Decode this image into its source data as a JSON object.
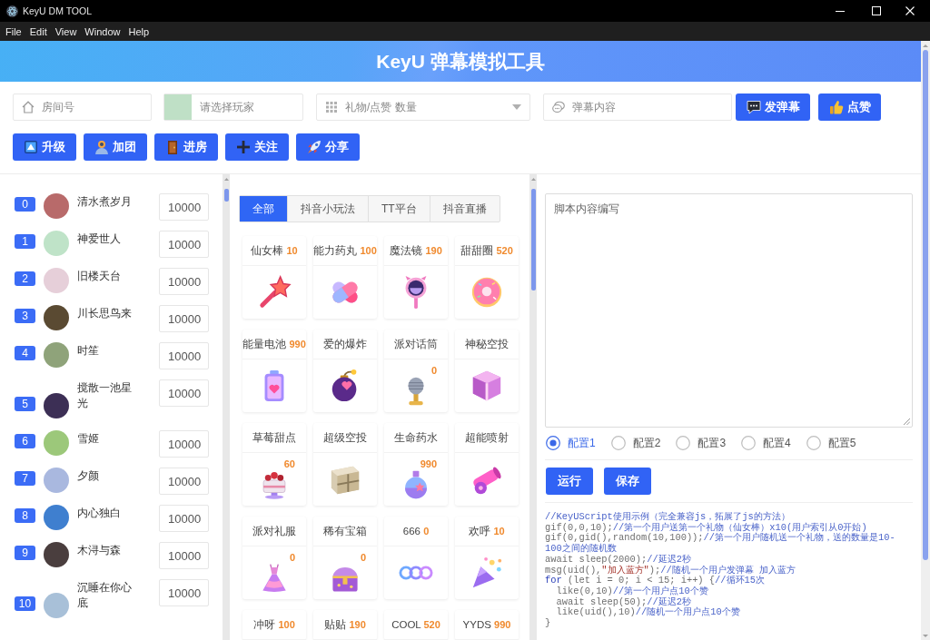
{
  "window": {
    "title": "KeyU DM TOOL"
  },
  "menu": [
    "File",
    "Edit",
    "View",
    "Window",
    "Help"
  ],
  "header": {
    "title": "KeyU 弹幕模拟工具"
  },
  "toolbar": {
    "room_field": {
      "placeholder": "房间号"
    },
    "player_select": {
      "placeholder": "请选择玩家"
    },
    "count_select": {
      "placeholder": "礼物/点赞 数量"
    },
    "danmaku_field": {
      "placeholder": "弹幕内容"
    },
    "buttons": [
      "发弹幕",
      "点赞"
    ],
    "actions": [
      "升级",
      "加团",
      "进房",
      "关注",
      "分享"
    ]
  },
  "players": [
    {
      "index": "0",
      "name": "清水煮岁月",
      "amount": "10000"
    },
    {
      "index": "1",
      "name": "神爱世人",
      "amount": "10000"
    },
    {
      "index": "2",
      "name": "旧楼天台",
      "amount": "10000"
    },
    {
      "index": "3",
      "name": "川长思鸟来",
      "amount": "10000"
    },
    {
      "index": "4",
      "name": "时笙",
      "amount": "10000"
    },
    {
      "index": "5",
      "name": "搅散一池星光",
      "amount": "10000"
    },
    {
      "index": "6",
      "name": "雪姬",
      "amount": "10000"
    },
    {
      "index": "7",
      "name": "夕颜",
      "amount": "10000"
    },
    {
      "index": "8",
      "name": "内心独白",
      "amount": "10000"
    },
    {
      "index": "9",
      "name": "木浔与森",
      "amount": "10000"
    },
    {
      "index": "10",
      "name": "沉睡在你心底",
      "amount": "10000"
    }
  ],
  "gift_tabs": [
    {
      "label": "全部",
      "selected": true
    },
    {
      "label": "抖音小玩法",
      "selected": false
    },
    {
      "label": "TT平台",
      "selected": false
    },
    {
      "label": "抖音直播",
      "selected": false
    }
  ],
  "gifts": [
    {
      "name": "仙女棒",
      "price": "10"
    },
    {
      "name": "能力药丸",
      "price": "100"
    },
    {
      "name": "魔法镜",
      "price": "190"
    },
    {
      "name": "甜甜圈",
      "price": "520"
    },
    {
      "name": "能量电池",
      "price": "990"
    },
    {
      "name": "爱的爆炸"
    },
    {
      "name": "派对话筒",
      "price_fragment": "0"
    },
    {
      "name": "神秘空投"
    },
    {
      "name": "草莓甜点",
      "price_fragment": "60"
    },
    {
      "name": "超级空投"
    },
    {
      "name": "生命药水",
      "price_fragment": "990"
    },
    {
      "name": "超能喷射"
    },
    {
      "name": "派对礼服",
      "price_fragment": "0"
    },
    {
      "name": "稀有宝箱",
      "price_fragment": "0"
    },
    {
      "name": "666",
      "price": "0"
    },
    {
      "name": "欢呼",
      "price": "10"
    },
    {
      "name": "冲呀",
      "price": "100"
    },
    {
      "name": "贴贴",
      "price": "190"
    },
    {
      "name": "COOL",
      "price": "520"
    },
    {
      "name": "YYDS",
      "price": "990"
    }
  ],
  "script": {
    "placeholder": "脚本内容编写",
    "configs": [
      {
        "label": "配置1",
        "selected": true
      },
      {
        "label": "配置2",
        "selected": false
      },
      {
        "label": "配置3",
        "selected": false
      },
      {
        "label": "配置4",
        "selected": false
      },
      {
        "label": "配置5",
        "selected": false
      }
    ],
    "buttons": [
      "运行",
      "保存"
    ],
    "code": [
      {
        "parts": [
          {
            "kind": "comment",
            "text": "//KeyUScript使用示例（完全兼容js，拓展了js的方法）"
          }
        ]
      },
      {
        "parts": [
          {
            "kind": "code",
            "text": "gif(0,0,10);"
          },
          {
            "kind": "comment",
            "text": "//第一个用户送第一个礼物（仙女棒）x10(用户索引从0开始)"
          }
        ]
      },
      {
        "parts": [
          {
            "kind": "code",
            "text": "gif(0,gid(),random(10,100));"
          },
          {
            "kind": "comment",
            "text": "//第一个用户随机送一个礼物，送的数量是10-100之间的随机数"
          }
        ]
      },
      {
        "parts": [
          {
            "kind": "code",
            "text": "await sleep(2000);"
          },
          {
            "kind": "comment",
            "text": "//延迟2秒"
          }
        ]
      },
      {
        "parts": [
          {
            "kind": "code",
            "text": "msg(uid(),"
          },
          {
            "kind": "string",
            "text": "\"加入蓝方\""
          },
          {
            "kind": "code",
            "text": ");"
          },
          {
            "kind": "comment",
            "text": "//随机一个用户发弹幕 加入蓝方"
          }
        ]
      },
      {
        "parts": [
          {
            "kind": "keyword",
            "text": "for"
          },
          {
            "kind": "code",
            "text": " (let i = 0; i < 15; i++) {"
          },
          {
            "kind": "comment",
            "text": "//循环15次"
          }
        ]
      },
      {
        "parts": [
          {
            "kind": "code",
            "text": "  like(0,10)"
          },
          {
            "kind": "comment",
            "text": "//第一个用户点10个赞"
          }
        ]
      },
      {
        "parts": [
          {
            "kind": "code",
            "text": "  await sleep(50);"
          },
          {
            "kind": "comment",
            "text": "//延迟2秒"
          }
        ]
      },
      {
        "parts": [
          {
            "kind": "code",
            "text": "  like(uid(),10)"
          },
          {
            "kind": "comment",
            "text": "//随机一个用户点10个赞"
          }
        ]
      },
      {
        "parts": [
          {
            "kind": "code",
            "text": "}"
          }
        ]
      }
    ]
  }
}
